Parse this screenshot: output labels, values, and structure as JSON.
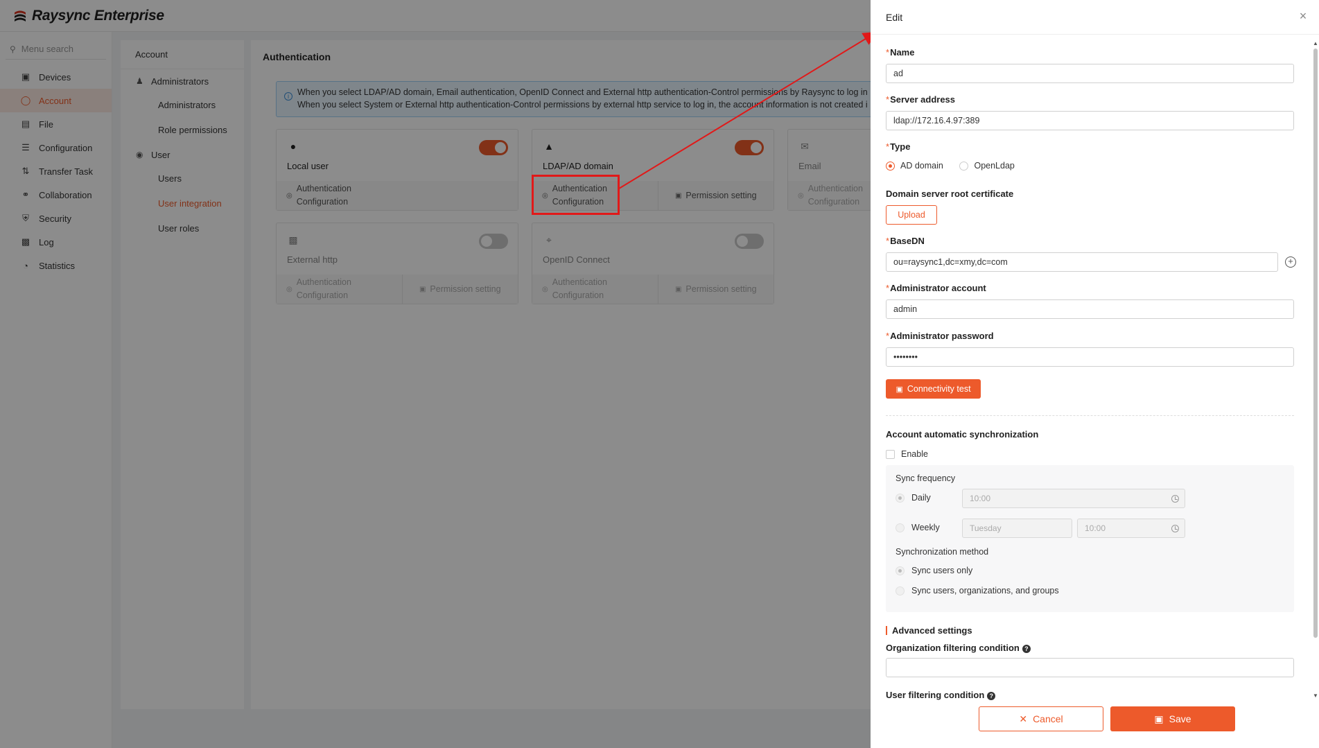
{
  "app": {
    "brand": "Raysync Enterprise"
  },
  "leftnav": {
    "search_placeholder": "Menu search",
    "items": [
      {
        "label": "Devices",
        "icon": "devices-icon"
      },
      {
        "label": "Account",
        "icon": "account-icon",
        "active": true
      },
      {
        "label": "File",
        "icon": "file-icon"
      },
      {
        "label": "Configuration",
        "icon": "configuration-icon"
      },
      {
        "label": "Transfer Task",
        "icon": "transfer-icon"
      },
      {
        "label": "Collaboration",
        "icon": "collaboration-icon"
      },
      {
        "label": "Security",
        "icon": "shield-icon"
      },
      {
        "label": "Log",
        "icon": "log-icon"
      },
      {
        "label": "Statistics",
        "icon": "statistics-icon"
      }
    ]
  },
  "subnav": {
    "header": "Account",
    "groups": [
      {
        "label": "Administrators",
        "items": [
          "Administrators",
          "Role permissions"
        ]
      },
      {
        "label": "User",
        "items": [
          "Users",
          "User integration",
          "User roles"
        ]
      }
    ],
    "active_item": "User integration"
  },
  "main": {
    "title": "Authentication",
    "notice_line1": "When you select LDAP/AD domain, Email authentication, OpenID Connect and External http authentication-Control permissions by Raysync to log in",
    "notice_line2": "When you select System or External http authentication-Control permissions by external http service to log in, the account information is not created i",
    "cards": [
      {
        "name": "Local user",
        "icon": "user-icon",
        "enabled": true,
        "auth_line1": "Authentication",
        "auth_line2": "Configuration",
        "permission": ""
      },
      {
        "name": "LDAP/AD domain",
        "icon": "ldap-icon",
        "enabled": true,
        "auth_line1": "Authentication",
        "auth_line2": "Configuration",
        "permission": "Permission setting"
      },
      {
        "name": "Email",
        "icon": "email-icon",
        "enabled": false,
        "auth_line1": "Authentication",
        "auth_line2": "Configuration",
        "permission": ""
      },
      {
        "name": "External http",
        "icon": "http-icon",
        "enabled": false,
        "auth_line1": "Authentication",
        "auth_line2": "Configuration",
        "permission": "Permission setting"
      },
      {
        "name": "OpenID Connect",
        "icon": "openid-icon",
        "enabled": false,
        "auth_line1": "Authentication",
        "auth_line2": "Configuration",
        "permission": "Permission setting"
      }
    ]
  },
  "drawer": {
    "title": "Edit",
    "name_label": "Name",
    "name_value": "ad",
    "server_label": "Server address",
    "server_value": "ldap://172.16.4.97:389",
    "type_label": "Type",
    "type_options": [
      "AD domain",
      "OpenLdap"
    ],
    "type_selected": "AD domain",
    "cert_label": "Domain server root certificate",
    "upload_label": "Upload",
    "basedn_label": "BaseDN",
    "basedn_value": "ou=raysync1,dc=xmy,dc=com",
    "admin_label": "Administrator account",
    "admin_value": "admin",
    "password_label": "Administrator password",
    "password_value": "••••••••",
    "test_label": "Connectivity test",
    "sync_title": "Account automatic synchronization",
    "enable_label": "Enable",
    "freq_label": "Sync frequency",
    "daily_label": "Daily",
    "daily_time": "10:00",
    "weekly_label": "Weekly",
    "weekly_day": "Tuesday",
    "weekly_time": "10:00",
    "method_label": "Synchronization method",
    "method_options": [
      "Sync users only",
      "Sync users, organizations, and groups"
    ],
    "advanced_label": "Advanced settings",
    "org_filter_label": "Organization filtering condition",
    "org_filter_value": "",
    "user_filter_label": "User filtering condition",
    "cancel_label": "Cancel",
    "save_label": "Save"
  },
  "colors": {
    "accent": "#ed5a2b",
    "highlight": "#e11919"
  }
}
